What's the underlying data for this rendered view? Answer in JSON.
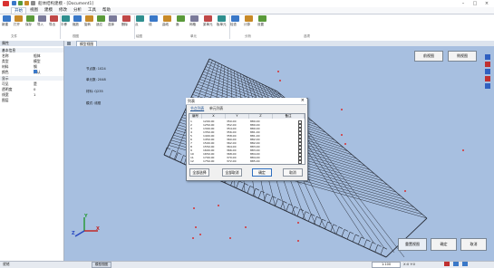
{
  "app": {
    "title": "船体结构建模 - [Document1]",
    "window_controls": [
      "–",
      "□",
      "×"
    ]
  },
  "menu": {
    "tabs": [
      "开始",
      "视图",
      "建模",
      "修改",
      "分析",
      "工具",
      "帮助"
    ],
    "active": "开始"
  },
  "ribbon": {
    "buttons": [
      {
        "label": "新建",
        "icon": "new-file-icon"
      },
      {
        "label": "打开",
        "icon": "open-folder-icon"
      },
      {
        "label": "保存",
        "icon": "save-icon"
      },
      {
        "label": "导入",
        "icon": "import-icon"
      },
      {
        "label": "导出",
        "icon": "export-icon"
      },
      {
        "label": "平移",
        "icon": "pan-icon"
      },
      {
        "label": "缩放",
        "icon": "zoom-icon"
      },
      {
        "label": "旋转",
        "icon": "rotate-icon"
      },
      {
        "label": "适应",
        "icon": "fit-icon"
      },
      {
        "label": "选择",
        "icon": "select-icon"
      },
      {
        "label": "删除",
        "icon": "delete-icon"
      },
      {
        "label": "点",
        "icon": "point-icon"
      },
      {
        "label": "线",
        "icon": "line-icon"
      },
      {
        "label": "曲线",
        "icon": "curve-icon"
      },
      {
        "label": "面",
        "icon": "surface-icon"
      },
      {
        "label": "网格",
        "icon": "mesh-icon"
      },
      {
        "label": "梁单元",
        "icon": "beam-icon"
      },
      {
        "label": "板单元",
        "icon": "plate-icon"
      },
      {
        "label": "检查",
        "icon": "check-icon"
      },
      {
        "label": "计算",
        "icon": "compute-icon"
      },
      {
        "label": "设置",
        "icon": "settings-icon"
      }
    ],
    "groups": [
      "文件",
      "视图",
      "绘图",
      "单元",
      "分析",
      "选项"
    ]
  },
  "left_panel": {
    "header": "属性",
    "sections": [
      {
        "title": "基本信息",
        "rows": [
          {
            "label": "名称",
            "value": "船体"
          },
          {
            "label": "类型",
            "value": "模型"
          },
          {
            "label": "材料",
            "value": "钢"
          },
          {
            "label": "颜色",
            "value": "默认"
          }
        ]
      },
      {
        "title": "显示",
        "rows": [
          {
            "label": "可见",
            "value": "是"
          },
          {
            "label": "透明度",
            "value": "0"
          },
          {
            "label": "线宽",
            "value": "1"
          },
          {
            "label": "图层",
            "value": ""
          }
        ]
      }
    ]
  },
  "doc_tab": "模型视图",
  "viewport": {
    "info_lines": [
      "节点数: 1024",
      "单元数: 2048",
      "材料: Q235",
      "模式: 线框"
    ],
    "top_buttons": [
      "前视图",
      "侧视图"
    ],
    "bottom_buttons": [
      "重置视图",
      "确定",
      "取消"
    ],
    "axes": {
      "x": "X",
      "y": "Y",
      "z": "Z"
    }
  },
  "dialog": {
    "title": "列表",
    "tabs": [
      "节点列表",
      "单元列表"
    ],
    "columns": [
      "编号",
      "X",
      "Y",
      "Z",
      "备注"
    ],
    "rows": [
      [
        "1",
        "1200.00",
        "350.00",
        "880.00",
        ""
      ],
      [
        "2",
        "1250.00",
        "352.00",
        "880.00",
        ""
      ],
      [
        "3",
        "1300.00",
        "354.00",
        "880.00",
        ""
      ],
      [
        "4",
        "1350.00",
        "356.00",
        "881.00",
        ""
      ],
      [
        "5",
        "1400.00",
        "358.00",
        "881.00",
        ""
      ],
      [
        "6",
        "1450.00",
        "360.00",
        "882.00",
        ""
      ],
      [
        "7",
        "1500.00",
        "362.00",
        "882.00",
        ""
      ],
      [
        "8",
        "1550.00",
        "364.00",
        "883.00",
        ""
      ],
      [
        "9",
        "1600.00",
        "366.00",
        "883.00",
        ""
      ],
      [
        "10",
        "1650.00",
        "368.00",
        "884.00",
        ""
      ],
      [
        "11",
        "1700.00",
        "370.00",
        "884.00",
        ""
      ],
      [
        "12",
        "1750.00",
        "372.00",
        "885.00",
        ""
      ]
    ],
    "buttons": [
      "全部选择",
      "全部取消",
      "确定",
      "取消"
    ]
  },
  "status": {
    "left": "就绪",
    "right_box": "1:100",
    "coords": "X:0 Y:0"
  },
  "colors": {
    "viewport_bg": "#a7bfe0",
    "wire": "#2a2f3a",
    "accent": "#1a4d8f",
    "marker": "#d83030"
  }
}
